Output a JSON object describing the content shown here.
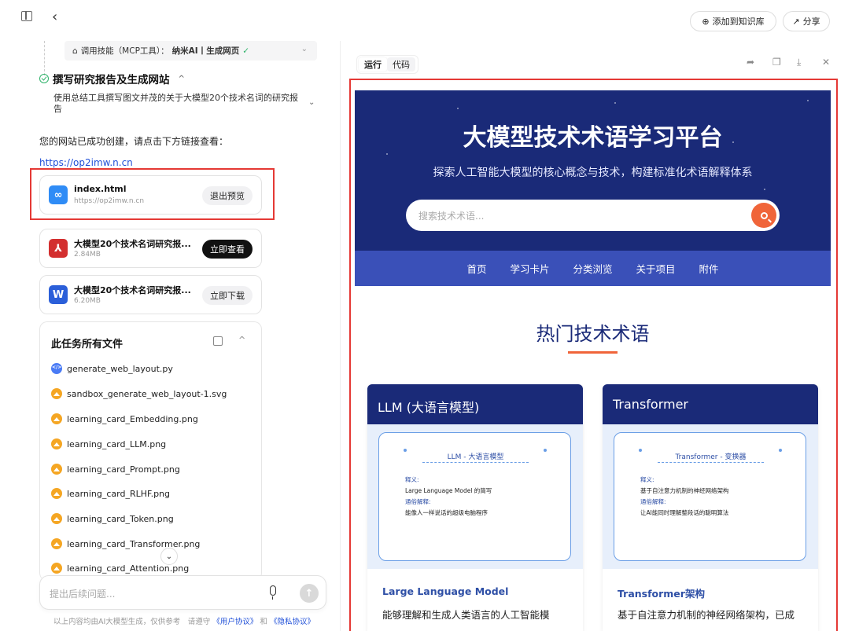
{
  "topbar": {
    "kb_label": "添加到知识库",
    "share_label": "分享"
  },
  "mcp": {
    "label": "调用技能（MCP工具）：",
    "tool": "纳米AI丨生成网页"
  },
  "task": {
    "title": "撰写研究报告及生成网站",
    "desc": "使用总结工具撰写图文并茂的关于大模型20个技术名词的研究报告"
  },
  "message": {
    "created": "您的网站已成功创建，请点击下方链接查看：",
    "link": "https://op2imw.n.cn"
  },
  "cards": [
    {
      "name": "index.html",
      "sub": "https://op2imw.n.cn",
      "button": "退出预览",
      "icon": "link-icon",
      "color": "#2f8cf6"
    },
    {
      "name": "大模型20个技术名词研究报...",
      "sub": "2.84MB",
      "button": "立即查看",
      "icon": "pdf-icon",
      "color": "#d32f2f"
    },
    {
      "name": "大模型20个技术名词研究报...",
      "sub": "6.20MB",
      "button": "立即下载",
      "icon": "word-icon",
      "color": "#2b5fd9"
    }
  ],
  "all_files": {
    "title": "此任务所有文件",
    "items": [
      "generate_web_layout.py",
      "sandbox_generate_web_layout-1.svg",
      "learning_card_Embedding.png",
      "learning_card_LLM.png",
      "learning_card_Prompt.png",
      "learning_card_RLHF.png",
      "learning_card_Token.png",
      "learning_card_Transformer.png",
      "learning_card_Attention.png"
    ]
  },
  "input": {
    "placeholder": "提出后续问题..."
  },
  "footer": {
    "note": "以上内容均由AI大模型生成，仅供参考　请遵守",
    "user_agreement": "《用户协议》",
    "and": "和",
    "privacy": "《隐私协议》"
  },
  "preview_tabs": [
    "运行",
    "代码"
  ],
  "site": {
    "title": "大模型技术术语学习平台",
    "subtitle": "探索人工智能大模型的核心概念与技术，构建标准化术语解释体系",
    "search_placeholder": "搜索技术术语...",
    "nav": [
      "首页",
      "学习卡片",
      "分类浏览",
      "关于项目",
      "附件"
    ],
    "hot_title": "热门技术术语",
    "terms": [
      {
        "header": "LLM (大语言模型)",
        "card_title": "LLM - 大语言模型",
        "def_label": "释义:",
        "def": "Large Language Model 的简写",
        "plain_label": "通俗解释:",
        "plain": "能像人一样说话的超级电脑程序",
        "name": "Large Language Model",
        "desc": "能够理解和生成人类语言的人工智能模"
      },
      {
        "header": "Transformer",
        "card_title": "Transformer - 变换器",
        "def_label": "释义:",
        "def": "基于自注意力机制的神经网络架构",
        "plain_label": "通俗解释:",
        "plain": "让AI能同时理解整段话的聪明算法",
        "name": "Transformer架构",
        "desc": "基于自注意力机制的神经网络架构，已成"
      }
    ]
  }
}
